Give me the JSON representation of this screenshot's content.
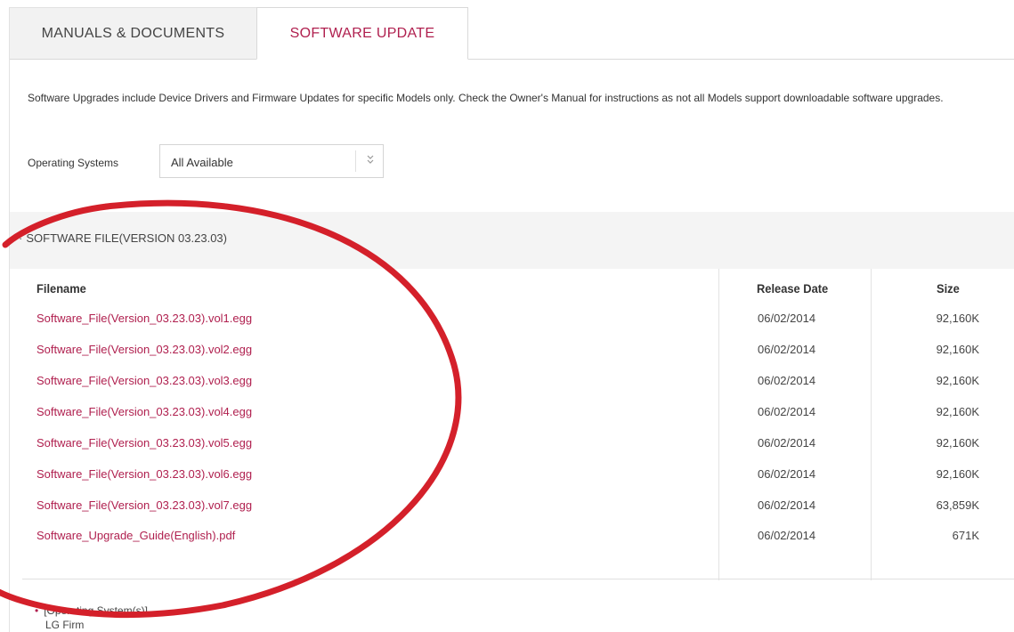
{
  "tabs": [
    {
      "label": "MANUALS & DOCUMENTS",
      "active": false
    },
    {
      "label": "SOFTWARE UPDATE",
      "active": true
    }
  ],
  "intro_text": "Software Upgrades include Device Drivers and Firmware Updates for specific Models only. Check the Owner's Manual for instructions as not all Models support downloadable software upgrades.",
  "os_filter": {
    "label": "Operating Systems",
    "selected": "All Available",
    "arrow_icon": "double-chevron-down-icon"
  },
  "section": {
    "title": "SOFTWARE FILE(VERSION 03.23.03)"
  },
  "table": {
    "headers": {
      "filename": "Filename",
      "release_date": "Release Date",
      "size": "Size"
    },
    "rows": [
      {
        "filename": "Software_File(Version_03.23.03).vol1.egg",
        "release_date": "06/02/2014",
        "size": "92,160K"
      },
      {
        "filename": "Software_File(Version_03.23.03).vol2.egg",
        "release_date": "06/02/2014",
        "size": "92,160K"
      },
      {
        "filename": "Software_File(Version_03.23.03).vol3.egg",
        "release_date": "06/02/2014",
        "size": "92,160K"
      },
      {
        "filename": "Software_File(Version_03.23.03).vol4.egg",
        "release_date": "06/02/2014",
        "size": "92,160K"
      },
      {
        "filename": "Software_File(Version_03.23.03).vol5.egg",
        "release_date": "06/02/2014",
        "size": "92,160K"
      },
      {
        "filename": "Software_File(Version_03.23.03).vol6.egg",
        "release_date": "06/02/2014",
        "size": "92,160K"
      },
      {
        "filename": "Software_File(Version_03.23.03).vol7.egg",
        "release_date": "06/02/2014",
        "size": "63,859K"
      },
      {
        "filename": "Software_Upgrade_Guide(English).pdf",
        "release_date": "06/02/2014",
        "size": "671K"
      }
    ]
  },
  "bottom_notes": [
    "[Operating System(s)]",
    "LG Firm"
  ],
  "colors": {
    "accent": "#b0204f",
    "annotation": "#d4202a",
    "section_bg": "#f4f4f4"
  }
}
